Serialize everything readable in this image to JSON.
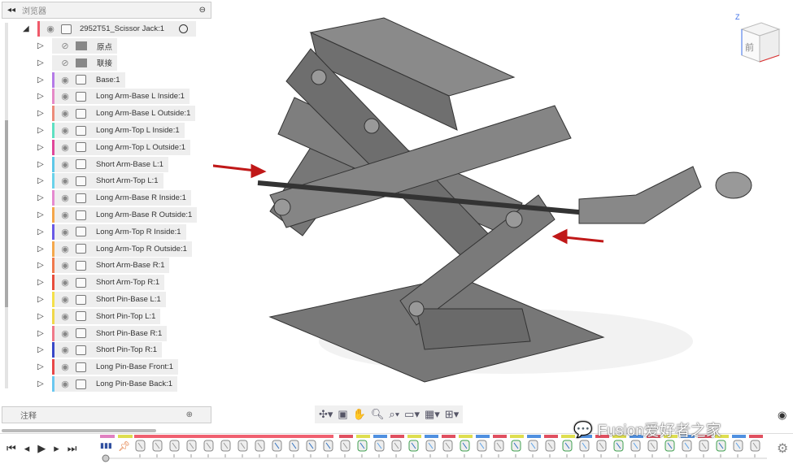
{
  "browser": {
    "title": "浏览器",
    "root": "2952T51_Scissor Jack:1",
    "notes": "注释",
    "items": [
      {
        "label": "原点",
        "type": "folder",
        "hidden": true,
        "color": ""
      },
      {
        "label": "联接",
        "type": "folder",
        "hidden": true,
        "color": ""
      },
      {
        "label": "Base:1",
        "type": "comp",
        "color": "#b57be8"
      },
      {
        "label": "Long Arm-Base L Inside:1",
        "type": "comp",
        "color": "#e58ac8"
      },
      {
        "label": "Long Arm-Base L Outside:1",
        "type": "comp",
        "color": "#ec8c7a"
      },
      {
        "label": "Long Arm-Top L Inside:1",
        "type": "comp",
        "color": "#5fe0c2"
      },
      {
        "label": "Long Arm-Top L Outside:1",
        "type": "comp",
        "color": "#e0479a"
      },
      {
        "label": "Short Arm-Base L:1",
        "type": "comp",
        "color": "#5ec8e8"
      },
      {
        "label": "Short Arm-Top L:1",
        "type": "comp",
        "color": "#6ad2ea"
      },
      {
        "label": "Long Arm-Base R Inside:1",
        "type": "comp",
        "color": "#e58ad0"
      },
      {
        "label": "Long Arm-Base R Outside:1",
        "type": "comp",
        "color": "#f4a64a"
      },
      {
        "label": "Long Arm-Top R Inside:1",
        "type": "comp",
        "color": "#6a5ae6"
      },
      {
        "label": "Long Arm-Top R Outside:1",
        "type": "comp",
        "color": "#f4a84c"
      },
      {
        "label": "Short Arm-Base R:1",
        "type": "comp",
        "color": "#f07a4e"
      },
      {
        "label": "Short Arm-Top R:1",
        "type": "comp",
        "color": "#e84d3c"
      },
      {
        "label": "Short Pin-Base L:1",
        "type": "comp",
        "color": "#f4e04a"
      },
      {
        "label": "Short Pin-Top L:1",
        "type": "comp",
        "color": "#f0d84a"
      },
      {
        "label": "Short Pin-Base R:1",
        "type": "comp",
        "color": "#f07a8a"
      },
      {
        "label": "Short Pin-Top R:1",
        "type": "comp",
        "color": "#3a48c8"
      },
      {
        "label": "Long Pin-Base Front:1",
        "type": "comp",
        "color": "#e84848"
      },
      {
        "label": "Long Pin-Base Back:1",
        "type": "comp",
        "color": "#6ac8f0"
      }
    ]
  },
  "viewcube": {
    "face": "前",
    "axis": "Z"
  },
  "watermark": "Fusion爱好者之家",
  "timeline": {
    "count": 37
  }
}
